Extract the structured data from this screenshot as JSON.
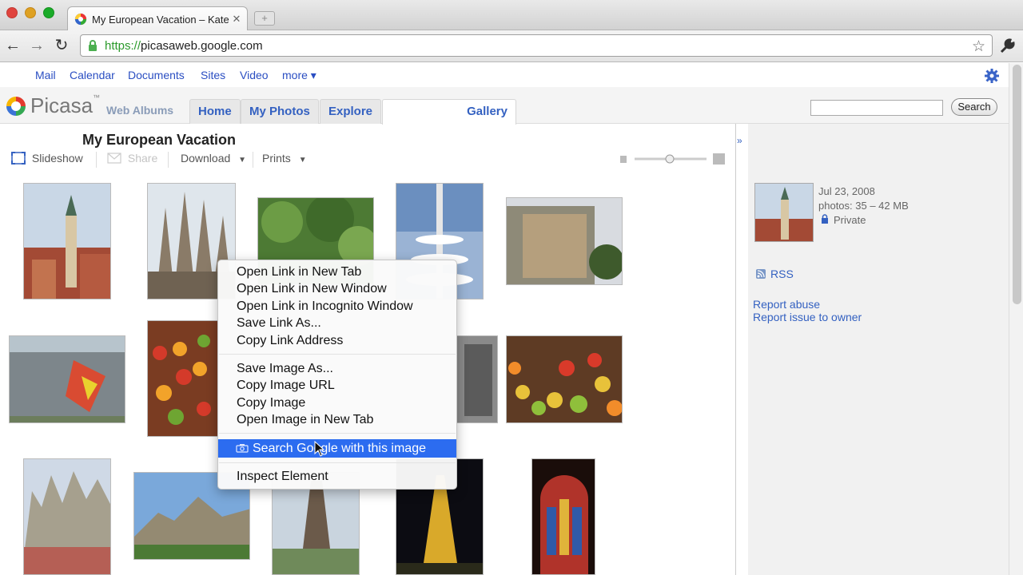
{
  "browser": {
    "tab_title": "My European Vacation – Kate",
    "tab_close": "✕",
    "newtab": "+",
    "url_scheme": "https://",
    "url_host": "picasaweb.google.com",
    "back": "←",
    "forward": "→",
    "reload": "↻",
    "star": "☆"
  },
  "gbar": {
    "links": [
      "Mail",
      "Calendar",
      "Documents",
      "Sites",
      "Video",
      "more ▾"
    ]
  },
  "picasa": {
    "logo_text": "Picasa",
    "logo_tm": "™",
    "logo_sub": "Web Albums",
    "tabs": [
      "Home",
      "My Photos",
      "Explore",
      "Gallery"
    ],
    "search_button": "Search",
    "search_placeholder": ""
  },
  "album": {
    "title": "My European Vacation",
    "actions": {
      "slideshow": "Slideshow",
      "share": "Share",
      "download": "Download",
      "prints": "Prints"
    }
  },
  "sidebar": {
    "date": "Jul 23, 2008",
    "photos": "photos: 35 – 42 MB",
    "privacy": "Private",
    "rss": "RSS",
    "report_abuse": "Report abuse",
    "report_owner": "Report issue to owner",
    "collapse": "»"
  },
  "context_menu": {
    "items": [
      "Open Link in New Tab",
      "Open Link in New Window",
      "Open Link in Incognito Window",
      "Save Link As...",
      "Copy Link Address",
      "Save Image As...",
      "Copy Image URL",
      "Copy Image",
      "Open Image in New Tab",
      "Search Google with this image",
      "Inspect Element"
    ]
  },
  "colors": {
    "link": "#2a4ec2",
    "tab_text": "#3461c1",
    "highlight": "#2c6cf0",
    "url_green": "#2a9a2a"
  }
}
